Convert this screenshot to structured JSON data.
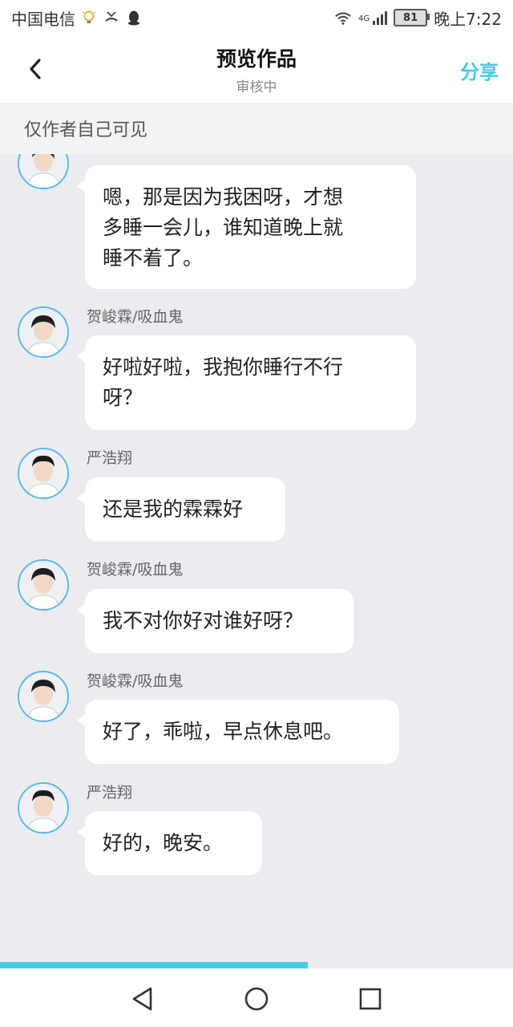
{
  "status_bar": {
    "carrier": "中国电信",
    "network_type": "4G",
    "battery_level": "81",
    "time": "晚上7:22",
    "left_icons": [
      "tips-bulb-icon",
      "missed-call-icon",
      "qq-icon"
    ],
    "right_icons": [
      "wifi-icon",
      "signal-icon"
    ]
  },
  "header": {
    "back_icon": "chevron-left-icon",
    "title": "预览作品",
    "subtitle": "审核中",
    "share_label": "分享",
    "accent_color": "#45cbe0"
  },
  "banner": {
    "text": "仅作者自己可见"
  },
  "messages": [
    {
      "sender": "",
      "text": "嗯，那是因为我困呀，才想多睡一会儿，谁知道晚上就睡不着了。",
      "lines": [
        "嗯，那是因为我困呀，才想",
        "多睡一会儿，谁知道晚上就",
        "睡不着了。"
      ]
    },
    {
      "sender": "贺峻霖/吸血鬼",
      "text": "好啦好啦，我抱你睡行不行呀？",
      "lines": [
        "好啦好啦，我抱你睡行不行",
        "呀？"
      ]
    },
    {
      "sender": "严浩翔",
      "text": "还是我的霖霖好",
      "lines": [
        "还是我的霖霖好"
      ]
    },
    {
      "sender": "贺峻霖/吸血鬼",
      "text": "我不对你好对谁好呀？",
      "lines": [
        "我不对你好对谁好呀？"
      ]
    },
    {
      "sender": "贺峻霖/吸血鬼",
      "text": "好了，乖啦，早点休息吧。",
      "lines": [
        "好了，乖啦，早点休息吧。"
      ]
    },
    {
      "sender": "严浩翔",
      "text": "好的，晚安。",
      "lines": [
        "好的，晚安。"
      ]
    }
  ],
  "progress": {
    "fraction": 0.6
  },
  "nav_bar": {
    "icons": [
      "back-triangle-icon",
      "home-circle-icon",
      "recents-square-icon"
    ]
  }
}
